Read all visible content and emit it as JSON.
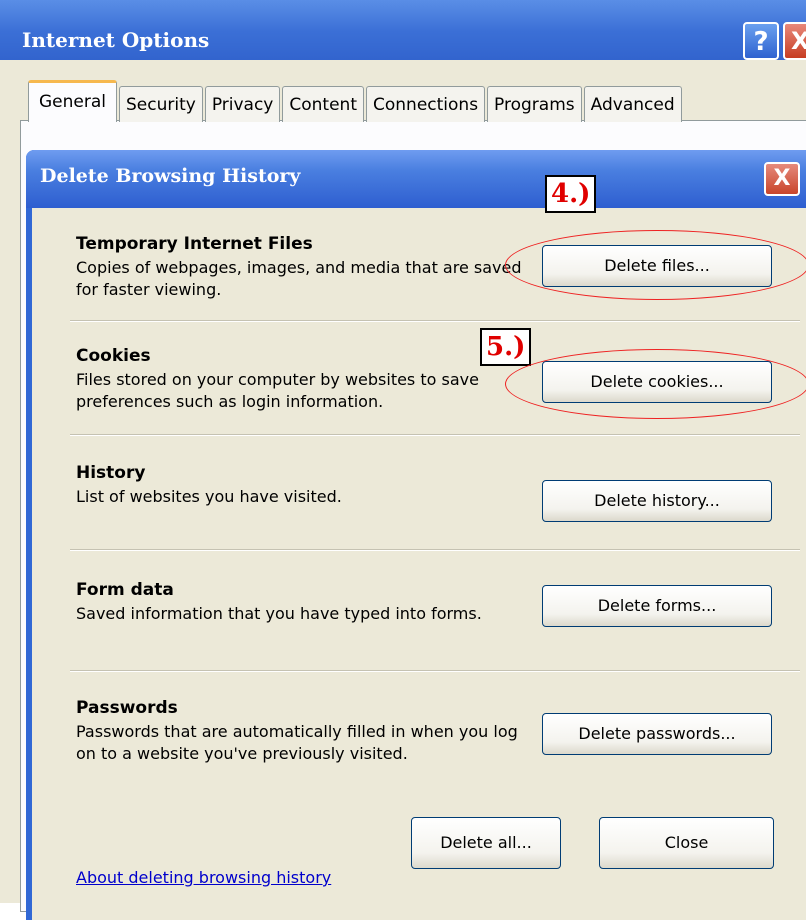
{
  "outer_window": {
    "title": "Internet Options",
    "help_label": "?",
    "close_label": "X",
    "tabs": [
      {
        "label": "General",
        "active": true
      },
      {
        "label": "Security",
        "active": false
      },
      {
        "label": "Privacy",
        "active": false
      },
      {
        "label": "Content",
        "active": false
      },
      {
        "label": "Connections",
        "active": false
      },
      {
        "label": "Programs",
        "active": false
      },
      {
        "label": "Advanced",
        "active": false
      }
    ]
  },
  "dialog": {
    "title": "Delete Browsing History",
    "close_label": "X",
    "sections": [
      {
        "title": "Temporary Internet Files",
        "description": "Copies of webpages, images, and media that are saved for faster viewing.",
        "button": "Delete files..."
      },
      {
        "title": "Cookies",
        "description": "Files stored on your computer by websites to save preferences such as login information.",
        "button": "Delete cookies..."
      },
      {
        "title": "History",
        "description": "List of websites you have visited.",
        "button": "Delete history..."
      },
      {
        "title": "Form data",
        "description": "Saved information that you have typed into forms.",
        "button": "Delete forms..."
      },
      {
        "title": "Passwords",
        "description": "Passwords that are automatically filled in when you log on to a website you've previously visited.",
        "button": "Delete passwords..."
      }
    ],
    "about_link": "About deleting browsing history",
    "delete_all_button": "Delete all...",
    "close_button": "Close"
  },
  "annotations": {
    "step4": "4.)",
    "step5": "5.)",
    "highlight_color": "#e22222"
  },
  "colors": {
    "titlebar_blue": "#2c5cc8",
    "dialog_bg": "#ece9d8",
    "close_red": "#c9452b",
    "link_blue": "#0000cc",
    "tab_highlight": "#f6b84e"
  }
}
